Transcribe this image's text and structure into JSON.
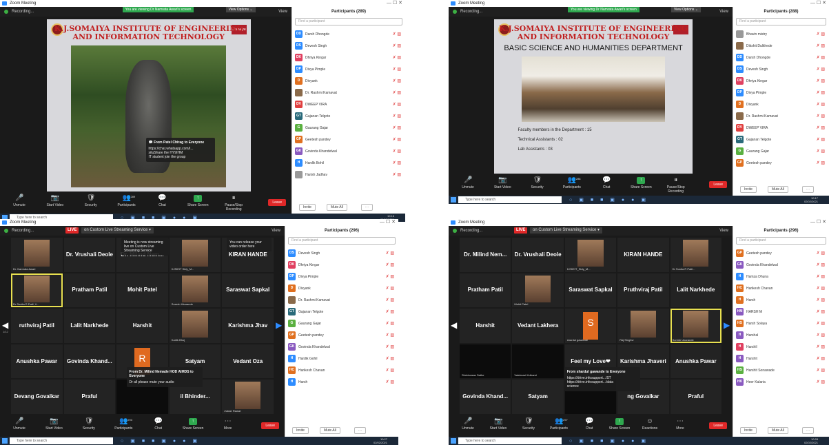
{
  "screens": [
    {
      "window_title": "Zoom Meeting",
      "viewing_banner": "You are viewing Dr Namrata Awari's screen",
      "view_options": "View Options ⌄",
      "recording": "Recording...",
      "view_label": "View",
      "slide_title_1": "K.J.SOMAIYA INSTITUTE OF ENGINEERING",
      "slide_title_2": "AND INFORMATION TECHNOLOGY",
      "logo_text": "Somaiya",
      "chat_popup": {
        "from": "From Patel Chirag to Everyone",
        "body": "https://chat.whatsapp.com/I...\nsituShare the HY9IHM\nIT student join the group"
      },
      "participants_title": "Participants (289)",
      "search_placeholder": "Find a participant",
      "participants": [
        {
          "initials": "DD",
          "name": "Darsh Dhongde",
          "color": "#2d8cff"
        },
        {
          "initials": "DS",
          "name": "Devesh Singh",
          "color": "#2d8cff"
        },
        {
          "initials": "DK",
          "name": "Dhriya Kingar",
          "color": "#e04060"
        },
        {
          "initials": "DP",
          "name": "Divya Pimple",
          "color": "#2d8cff"
        },
        {
          "initials": "D",
          "name": "Divyank",
          "color": "#e07020"
        },
        {
          "initials": "",
          "name": "Dr. Rashmi Kamavat",
          "color": "#8a6a4a"
        },
        {
          "initials": "DV",
          "name": "DWEEP VIRA",
          "color": "#e04040"
        },
        {
          "initials": "GT",
          "name": "Gajanan Telgote",
          "color": "#2a6a7a"
        },
        {
          "initials": "G",
          "name": "Gaurang Gajar",
          "color": "#5ab040"
        },
        {
          "initials": "GP",
          "name": "Geetesh pandey",
          "color": "#e07020"
        },
        {
          "initials": "GK",
          "name": "Govinda Khandelwal",
          "color": "#8a5ac0"
        },
        {
          "initials": "H",
          "name": "Hardik Bohil",
          "color": "#2d8cff"
        },
        {
          "initials": "",
          "name": "Harish Jadhav",
          "color": "#999"
        }
      ],
      "invite": "Invite",
      "mute_all": "Mute All",
      "toolbar": [
        "Unmute",
        "Start Video",
        "Security",
        "Participants",
        "Chat",
        "Share Screen",
        "Pause/Stop Recording"
      ],
      "participant_count": "289",
      "leave": "Leave",
      "search_taskbar": "Type here to search",
      "clock": [
        "10:16",
        "02/02/2021"
      ]
    },
    {
      "window_title": "Zoom Meeting",
      "viewing_banner": "You are viewing Dr Namrata Awari's screen",
      "view_options": "View Options ⌄",
      "recording": "Recording...",
      "view_label": "View",
      "slide_title_1": "K.J.SOMAIYA INSTITUTE OF ENGINEERING",
      "slide_title_2": "AND INFORMATION TECHNOLOGY",
      "dept": "BASIC SCIENCE AND HUMANITIES DEPARTMENT",
      "bullets": [
        "Faculty members in the Department : 15",
        "Technical Assistants : 02",
        "Lab Assistants : 03"
      ],
      "participants_title": "Participants (288)",
      "search_placeholder": "Find a participant",
      "participants": [
        {
          "initials": "",
          "name": "Bhavin mistry",
          "color": "#999"
        },
        {
          "initials": "",
          "name": "Dikshit Dulkhede",
          "color": "#8a6a4a"
        },
        {
          "initials": "DD",
          "name": "Darsh Dhongde",
          "color": "#2d8cff"
        },
        {
          "initials": "DS",
          "name": "Devesh Singh",
          "color": "#2d8cff"
        },
        {
          "initials": "DK",
          "name": "Dhriya Kingar",
          "color": "#e04060"
        },
        {
          "initials": "DP",
          "name": "Divya Pimple",
          "color": "#2d8cff"
        },
        {
          "initials": "D",
          "name": "Divyank",
          "color": "#e07020"
        },
        {
          "initials": "",
          "name": "Dr. Rashmi Kamavat",
          "color": "#8a6a4a"
        },
        {
          "initials": "DV",
          "name": "DWEEP VIRA",
          "color": "#e04040"
        },
        {
          "initials": "GT",
          "name": "Gajanan Telgote",
          "color": "#2a6a7a"
        },
        {
          "initials": "G",
          "name": "Gaurang Gajar",
          "color": "#5ab040"
        },
        {
          "initials": "GP",
          "name": "Geetesh pandey",
          "color": "#e07020"
        }
      ],
      "invite": "Invite",
      "mute_all": "Mute All",
      "toolbar": [
        "Unmute",
        "Start Video",
        "Security",
        "Participants",
        "Chat",
        "Share Screen",
        "Pause/Stop Recording"
      ],
      "participant_count": "288",
      "leave": "Leave",
      "search_taskbar": "Type here to search",
      "clock": [
        "10:17",
        "02/02/2021"
      ]
    },
    {
      "window_title": "Zoom Meeting",
      "recording": "Recording...",
      "live": "LIVE",
      "streaming": "on Custom Live Streaming Service ▾",
      "view_label": "View",
      "stream_popup_1": "Meeting is now streaming live on Custom Live Streaming Service",
      "stream_popup_2": "You can release your video order here",
      "tiles": [
        {
          "name": "",
          "sub": "Dr. Namrata Awari",
          "type": "photo"
        },
        {
          "name": "Dr. Vrushali Deole",
          "sub": "",
          "type": "name"
        },
        {
          "name": "Dr. Milind Nem...",
          "sub": "",
          "type": "name"
        },
        {
          "name": "",
          "sub": "KJSIEIT Stdy_M...",
          "type": "photo"
        },
        {
          "name": "KIRAN HANDE",
          "sub": "",
          "type": "name"
        },
        {
          "name": "",
          "sub": "Dr Sunita R Patil, V...",
          "type": "photo",
          "hl": true
        },
        {
          "name": "Pratham Patil",
          "sub": "",
          "type": "name"
        },
        {
          "name": "Mohit Patel",
          "sub": "",
          "type": "name"
        },
        {
          "name": "",
          "sub": "Suresh Ukarande",
          "type": "photo"
        },
        {
          "name": "Saraswat Sapkal",
          "sub": "",
          "type": "name"
        },
        {
          "name": "ruthviraj Patil",
          "sub": "",
          "type": "name"
        },
        {
          "name": "Lalit Narkhede",
          "sub": "",
          "type": "name"
        },
        {
          "name": "Harshit",
          "sub": "",
          "type": "name"
        },
        {
          "name": "",
          "sub": "Kartik Bhoj",
          "type": "photo"
        },
        {
          "name": "Karishma Jhav",
          "sub": "",
          "type": "name"
        },
        {
          "name": "Anushka Pawar",
          "sub": "",
          "type": "name"
        },
        {
          "name": "Govinda Khand...",
          "sub": "",
          "type": "name"
        },
        {
          "name": "R",
          "sub": "",
          "type": "letter",
          "color": "#e06a20"
        },
        {
          "name": "Satyam",
          "sub": "",
          "type": "name"
        },
        {
          "name": "Vedant Oza",
          "sub": "",
          "type": "name"
        },
        {
          "name": "Devang Govalkar",
          "sub": "",
          "type": "name"
        },
        {
          "name": "Praful",
          "sub": "",
          "type": "name"
        },
        {
          "name": "",
          "sub": "",
          "type": "blank"
        },
        {
          "name": "il Bhinder...",
          "sub": "",
          "type": "name"
        },
        {
          "name": "",
          "sub": "Zubair Rawat",
          "type": "photo"
        }
      ],
      "page": "1/12",
      "chat_popup": {
        "from": "From Dr. Milind Nemade HOD AIMDS to Everyone",
        "body": "Dr all please mute your audio"
      },
      "participants_title": "Participants (296)",
      "search_placeholder": "Find a participant",
      "participants": [
        {
          "initials": "DS",
          "name": "Devesh Singh",
          "color": "#2d8cff"
        },
        {
          "initials": "DK",
          "name": "Dhriya Kingar",
          "color": "#e04060"
        },
        {
          "initials": "DP",
          "name": "Divya Pimple",
          "color": "#2d8cff"
        },
        {
          "initials": "D",
          "name": "Divyank",
          "color": "#e07020"
        },
        {
          "initials": "",
          "name": "Dr. Rashmi Kamavat",
          "color": "#8a6a4a"
        },
        {
          "initials": "GT",
          "name": "Gajanan Telgote",
          "color": "#2a6a7a"
        },
        {
          "initials": "G",
          "name": "Gaurang Gajar",
          "color": "#5ab040"
        },
        {
          "initials": "GP",
          "name": "Geetesh pandey",
          "color": "#e07020"
        },
        {
          "initials": "GK",
          "name": "Govinda Khandelwal",
          "color": "#8a5ac0"
        },
        {
          "initials": "H",
          "name": "Hardik Gohil",
          "color": "#2d8cff"
        },
        {
          "initials": "HC",
          "name": "Harikesh Chavan",
          "color": "#e07020"
        },
        {
          "initials": "H",
          "name": "Harsh",
          "color": "#2d8cff"
        }
      ],
      "invite": "Invite",
      "mute_all": "Mute All",
      "toolbar": [
        "Unmute",
        "Start Video",
        "Security",
        "Participants",
        "Chat",
        "Share Screen",
        "More"
      ],
      "participant_count": "293",
      "leave": "Leave",
      "search_taskbar": "Type here to search",
      "clock": [
        "10:27",
        "02/02/2021"
      ]
    },
    {
      "window_title": "Zoom Meeting",
      "recording": "Recording...",
      "live": "LIVE",
      "streaming": "on Custom Live Streaming Service ▾",
      "view_label": "View",
      "tiles": [
        {
          "name": "Dr. Milind Nem...",
          "sub": "",
          "type": "name"
        },
        {
          "name": "Dr. Vrushali Deole",
          "sub": "",
          "type": "name"
        },
        {
          "name": "",
          "sub": "KJSIEIT_Stdy_M...",
          "type": "photo"
        },
        {
          "name": "KIRAN HANDE",
          "sub": "",
          "type": "name"
        },
        {
          "name": "",
          "sub": "Dr Sunita R Patil...",
          "type": "photo"
        },
        {
          "name": "Pratham Patil",
          "sub": "",
          "type": "name"
        },
        {
          "name": "",
          "sub": "Mohit Patel",
          "type": "photo"
        },
        {
          "name": "Saraswat Sapkal",
          "sub": "",
          "type": "name"
        },
        {
          "name": "Pruthviraj Patil",
          "sub": "",
          "type": "name"
        },
        {
          "name": "Lalit Narkhede",
          "sub": "",
          "type": "name"
        },
        {
          "name": "Harshit",
          "sub": "",
          "type": "name"
        },
        {
          "name": "Vedant Lakhera",
          "sub": "",
          "type": "name"
        },
        {
          "name": "S",
          "sub": "shardul gawande",
          "type": "letter",
          "color": "#e06a20"
        },
        {
          "name": "",
          "sub": "Raj Singhvi",
          "type": "photo"
        },
        {
          "name": "",
          "sub": "Suresh Ukarande",
          "type": "photo",
          "hl": true
        },
        {
          "name": "",
          "sub": "Shrinivasan Sathe",
          "type": "blank"
        },
        {
          "name": "",
          "sub": "Vaishnavi Kulkarni",
          "type": "blank"
        },
        {
          "name": "Feel my Love❤",
          "sub": "",
          "type": "name"
        },
        {
          "name": "Karishma Jhaveri",
          "sub": "",
          "type": "name"
        },
        {
          "name": "Anushka Pawar",
          "sub": "",
          "type": "name"
        },
        {
          "name": "Govinda Khand...",
          "sub": "",
          "type": "name"
        },
        {
          "name": "Satyam",
          "sub": "",
          "type": "name"
        },
        {
          "name": "",
          "sub": "",
          "type": "blank"
        },
        {
          "name": "ng Govalkar",
          "sub": "",
          "type": "name"
        },
        {
          "name": "Praful",
          "sub": "",
          "type": "name"
        }
      ],
      "chat_popup": {
        "from": "From shardul gawande to Everyone",
        "body": "https://drive.infosupport.../ST\nhttps://drive.infosupport.../data\nscience"
      },
      "participants_title": "Participants (296)",
      "search_placeholder": "Find a participant",
      "participants": [
        {
          "initials": "GP",
          "name": "Geetesh pandey",
          "color": "#e07020"
        },
        {
          "initials": "GK",
          "name": "Govinda Khandelwal",
          "color": "#8a5ac0"
        },
        {
          "initials": "H",
          "name": "Hamza Dhuna",
          "color": "#2d8cff"
        },
        {
          "initials": "HC",
          "name": "Harikesh Chavan",
          "color": "#e07020"
        },
        {
          "initials": "H",
          "name": "Harsh",
          "color": "#e07020"
        },
        {
          "initials": "HM",
          "name": "HARSH M",
          "color": "#8a5ac0"
        },
        {
          "initials": "HS",
          "name": "Harsh Solaya",
          "color": "#e07020"
        },
        {
          "initials": "H",
          "name": "Harshal",
          "color": "#8a5ac0"
        },
        {
          "initials": "H",
          "name": "Harshil",
          "color": "#e04060"
        },
        {
          "initials": "H",
          "name": "Harshit",
          "color": "#8a5ac0"
        },
        {
          "initials": "HS",
          "name": "Harshit Sonawade",
          "color": "#5ab040"
        },
        {
          "initials": "HK",
          "name": "Heer Kalaria",
          "color": "#8a5ac0"
        }
      ],
      "invite": "Invite",
      "mute_all": "Mute All",
      "toolbar": [
        "Unmute",
        "Start Video",
        "Security",
        "Participants",
        "Chat",
        "Share Screen",
        "Reactions",
        "More"
      ],
      "participant_count": "297",
      "leave": "Leave",
      "search_taskbar": "Type here to search",
      "clock": [
        "10:28",
        "02/02/2021"
      ]
    }
  ]
}
